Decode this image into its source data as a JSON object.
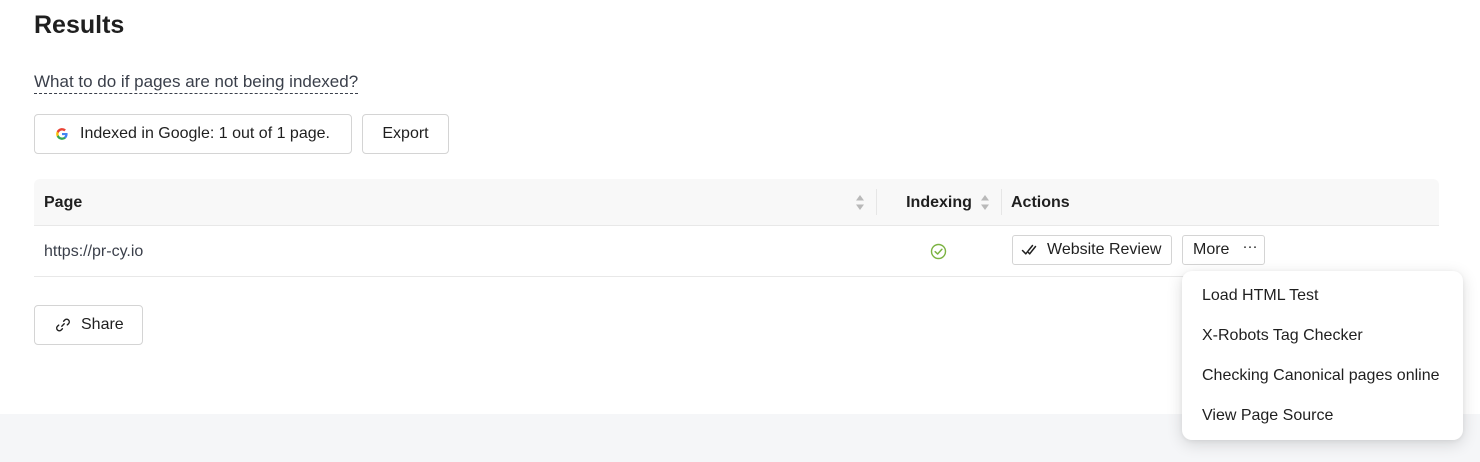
{
  "heading": "Results",
  "help_link": "What to do if pages are not being indexed?",
  "toolbar": {
    "indexed_label": "Indexed in Google: 1 out of 1 page.",
    "export_label": "Export"
  },
  "table": {
    "columns": {
      "page": "Page",
      "indexing": "Indexing",
      "actions": "Actions"
    },
    "rows": [
      {
        "url": "https://pr-cy.io",
        "indexed": true,
        "review_label": "Website Review",
        "more_label": "More",
        "more_dots": "···"
      }
    ]
  },
  "share_label": "Share",
  "more_menu": {
    "items": [
      "Load HTML Test",
      "X-Robots Tag Checker",
      "Checking Canonical pages online",
      "View Page Source"
    ]
  },
  "icons": {
    "google": "google-icon",
    "sort": "sort-icon",
    "indexed": "check-circle-icon",
    "review": "double-check-icon",
    "share": "link-icon"
  },
  "colors": {
    "indexed_green": "#7cb342",
    "link_text": "#3a3f4a",
    "header_bg": "#f8f8f8",
    "footer_bg": "#f5f6f8"
  }
}
